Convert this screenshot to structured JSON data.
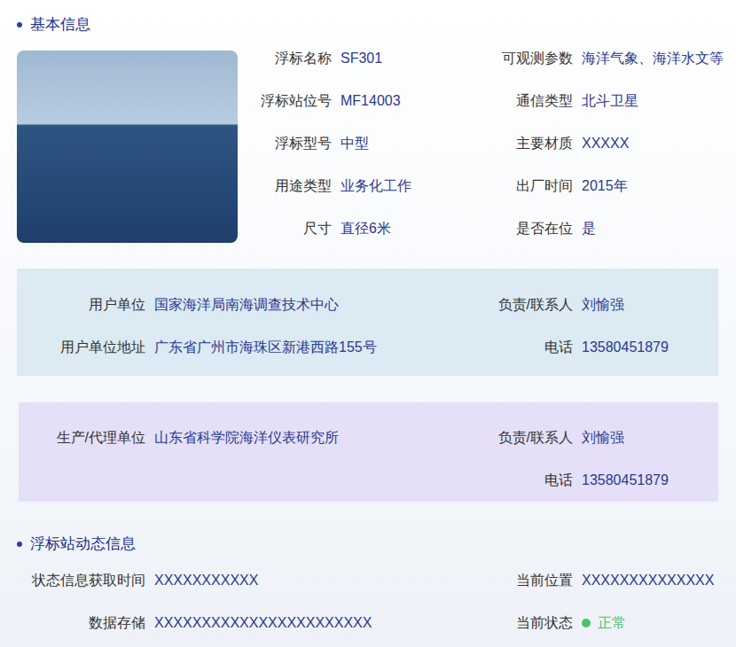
{
  "basic_info": {
    "title": "基本信息",
    "rows": [
      {
        "left": {
          "label": "浮标名称",
          "value": "SF301"
        },
        "right": {
          "label": "可观测参数",
          "value": "海洋气象、海洋水文等"
        }
      },
      {
        "left": {
          "label": "浮标站位号",
          "value": "MF14003"
        },
        "right": {
          "label": "通信类型",
          "value": "北斗卫星"
        }
      },
      {
        "left": {
          "label": "浮标型号",
          "value": "中型"
        },
        "right": {
          "label": "主要材质",
          "value": "XXXXX"
        }
      },
      {
        "left": {
          "label": "用途类型",
          "value": "业务化工作"
        },
        "right": {
          "label": "出厂时间",
          "value": "2015年"
        }
      },
      {
        "left": {
          "label": "尺寸",
          "value": "直径6米"
        },
        "right": {
          "label": "是否在位",
          "value": "是"
        }
      }
    ]
  },
  "user_unit": {
    "rows": [
      {
        "left": {
          "label": "用户单位",
          "value": "国家海洋局南海调查技术中心"
        },
        "right": {
          "label": "负责/联系人",
          "value": "刘愉强"
        }
      },
      {
        "left": {
          "label": "用户单位地址",
          "value": "广东省广州市海珠区新港西路155号"
        },
        "right": {
          "label": "电话",
          "value": "13580451879"
        }
      }
    ]
  },
  "producer": {
    "rows": [
      {
        "left": {
          "label": "生产/代理单位",
          "value": "山东省科学院海洋仪表研究所"
        },
        "right": {
          "label": "负责/联系人",
          "value": "刘愉强"
        }
      },
      {
        "left": {
          "label": "",
          "value": ""
        },
        "right": {
          "label": "电话",
          "value": "13580451879"
        }
      }
    ]
  },
  "dynamic_info": {
    "title": "浮标站动态信息",
    "rows": [
      {
        "left": {
          "label": "状态信息获取时间",
          "value": "XXXXXXXXXXX"
        },
        "right": {
          "label": "当前位置",
          "value": "XXXXXXXXXXXXXX",
          "kind": "text",
          "color": ""
        }
      },
      {
        "left": {
          "label": "数据存储",
          "value": "XXXXXXXXXXXXXXXXXXXXXXX"
        },
        "right": {
          "label": "当前状态",
          "value": "正常",
          "kind": "status",
          "color": "#4cc36a"
        }
      }
    ]
  }
}
